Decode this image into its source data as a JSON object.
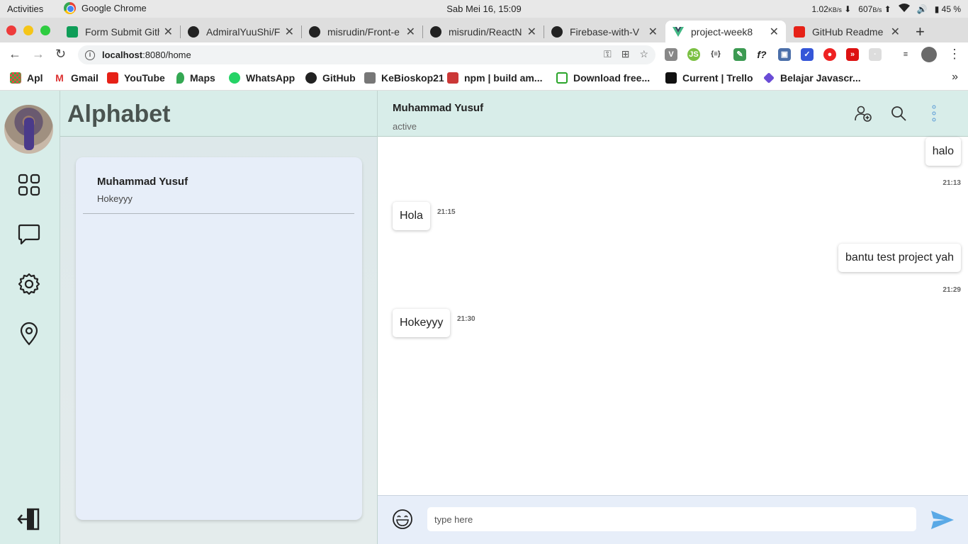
{
  "system": {
    "activities": "Activities",
    "app_name": "Google Chrome",
    "clock": "Sab Mei 16, 15:09",
    "net_down": "1.02",
    "net_down_unit": "KB/s",
    "net_up": "607",
    "net_up_unit": "B/s",
    "battery": "45 %"
  },
  "tabs": [
    {
      "title": "Form Submit Gith",
      "icon": "sheets-icon"
    },
    {
      "title": "AdmiralYuuShi/F",
      "icon": "github-icon"
    },
    {
      "title": "misrudin/Front-e",
      "icon": "github-icon"
    },
    {
      "title": "misrudin/ReactN",
      "icon": "github-icon"
    },
    {
      "title": "Firebase-with-V",
      "icon": "github-icon"
    },
    {
      "title": "project-week8",
      "icon": "vue-icon",
      "active": true
    },
    {
      "title": "GitHub Readme",
      "icon": "youtube-icon"
    }
  ],
  "toolbar": {
    "url_host": "localhost",
    "url_rest": ":8080/home"
  },
  "bookmarks": [
    {
      "label": "Apl",
      "icon": "apps-grid-icon"
    },
    {
      "label": "Gmail",
      "icon": "gmail-icon"
    },
    {
      "label": "YouTube",
      "icon": "youtube-icon"
    },
    {
      "label": "Maps",
      "icon": "maps-icon"
    },
    {
      "label": "WhatsApp",
      "icon": "whatsapp-icon"
    },
    {
      "label": "GitHub",
      "icon": "github-icon"
    },
    {
      "label": "KeBioskop21",
      "icon": "tv-icon"
    },
    {
      "label": "npm | build am...",
      "icon": "npm-icon"
    },
    {
      "label": "Download free...",
      "icon": "download-icon"
    },
    {
      "label": "Current | Trello",
      "icon": "trello-icon"
    },
    {
      "label": "Belajar Javascr...",
      "icon": "code-icon"
    }
  ],
  "app": {
    "brand": "Alphabet",
    "contacts": [
      {
        "name": "Muhammad Yusuf",
        "last_message": "Hokeyyy"
      }
    ],
    "chat": {
      "name": "Muhammad Yusuf",
      "status": "active",
      "messages": [
        {
          "text": "halo",
          "time": "21:13",
          "side": "right"
        },
        {
          "text": "Hola",
          "time": "21:15",
          "side": "left"
        },
        {
          "text": "bantu test project yah",
          "time": "21:29",
          "side": "right"
        },
        {
          "text": "Hokeyyy",
          "time": "21:30",
          "side": "left"
        }
      ],
      "input_placeholder": "type here"
    }
  },
  "colors": {
    "panel_bg": "#d8ede9",
    "card_bg": "#e7eef9",
    "send": "#5aa9e6"
  }
}
